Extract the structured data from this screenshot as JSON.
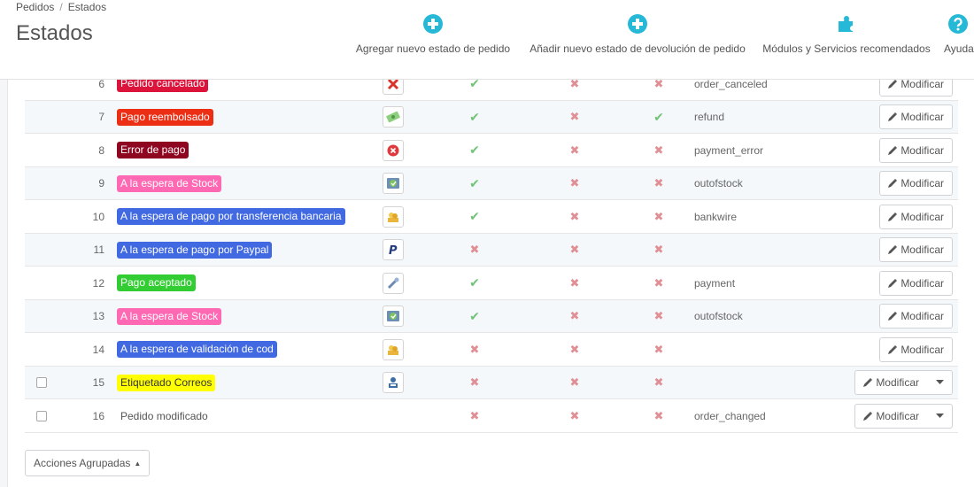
{
  "breadcrumb": {
    "parent": "Pedidos",
    "separator": "/",
    "current": "Estados"
  },
  "page_title": "Estados",
  "toolbar": {
    "add_order_state": {
      "label": "Agregar nuevo estado de pedido",
      "icon": "plus-circle-icon"
    },
    "add_return_state": {
      "label": "Añadir nuevo estado de devolución de pedido",
      "icon": "plus-circle-icon"
    },
    "modules": {
      "label": "Módulos y Servicios recomendados",
      "icon": "puzzle-icon"
    },
    "help": {
      "label": "Ayuda",
      "icon": "question-circle-icon"
    }
  },
  "colors": {
    "accent": "#25b9d7",
    "check": "#72c279",
    "cross": "#e08f95"
  },
  "table": {
    "rows": [
      {
        "id": "6",
        "name": "Pedido cancelado",
        "color": "#dc143c",
        "icon": "cancel-icon",
        "m1": "yes",
        "m2": "no",
        "m3": "no",
        "template": "order_canceled",
        "action": "Modificar",
        "checkbox": false,
        "dropdown": false
      },
      {
        "id": "7",
        "name": "Pago reembolsado",
        "color": "#ec2e15",
        "icon": "refund-icon",
        "m1": "yes",
        "m2": "no",
        "m3": "yes",
        "template": "refund",
        "action": "Modificar",
        "checkbox": false,
        "dropdown": false
      },
      {
        "id": "8",
        "name": "Error de pago",
        "color": "#8f0621",
        "icon": "payment-error-icon",
        "m1": "yes",
        "m2": "no",
        "m3": "no",
        "template": "payment_error",
        "action": "Modificar",
        "checkbox": false,
        "dropdown": false
      },
      {
        "id": "9",
        "name": "A la espera de Stock",
        "color": "#ff69b4",
        "icon": "stock-icon",
        "m1": "yes",
        "m2": "no",
        "m3": "no",
        "template": "outofstock",
        "action": "Modificar",
        "checkbox": false,
        "dropdown": false
      },
      {
        "id": "10",
        "name": "A la espera de pago por transferencia bancaria",
        "color": "#4169e1",
        "icon": "bankwire-icon",
        "m1": "yes",
        "m2": "no",
        "m3": "no",
        "template": "bankwire",
        "action": "Modificar",
        "checkbox": false,
        "dropdown": false
      },
      {
        "id": "11",
        "name": "A la espera de pago por Paypal",
        "color": "#4169e1",
        "icon": "paypal-icon",
        "m1": "no",
        "m2": "no",
        "m3": "no",
        "template": "",
        "action": "Modificar",
        "checkbox": false,
        "dropdown": false
      },
      {
        "id": "12",
        "name": "Pago aceptado",
        "color": "#32cd32",
        "icon": "payment-accepted-icon",
        "m1": "yes",
        "m2": "no",
        "m3": "no",
        "template": "payment",
        "action": "Modificar",
        "checkbox": false,
        "dropdown": false
      },
      {
        "id": "13",
        "name": "A la espera de Stock",
        "color": "#ff69b4",
        "icon": "stock-icon",
        "m1": "yes",
        "m2": "no",
        "m3": "no",
        "template": "outofstock",
        "action": "Modificar",
        "checkbox": false,
        "dropdown": false
      },
      {
        "id": "14",
        "name": "A la espera de validación de cod",
        "color": "#4169e1",
        "icon": "cod-icon",
        "m1": "no",
        "m2": "no",
        "m3": "no",
        "template": "",
        "action": "Modificar",
        "checkbox": false,
        "dropdown": false
      },
      {
        "id": "15",
        "name": "Etiquetado Correos",
        "color": "#ffff00",
        "text_color": "#333333",
        "icon": "correos-icon",
        "m1": "no",
        "m2": "no",
        "m3": "no",
        "template": "",
        "action": "Modificar",
        "checkbox": true,
        "dropdown": true
      },
      {
        "id": "16",
        "name": "Pedido modificado",
        "color": "",
        "icon": "",
        "m1": "no",
        "m2": "no",
        "m3": "no",
        "template": "order_changed",
        "action": "Modificar",
        "checkbox": true,
        "dropdown": true
      }
    ]
  },
  "bulk_actions": {
    "label": "Acciones Agrupadas"
  }
}
